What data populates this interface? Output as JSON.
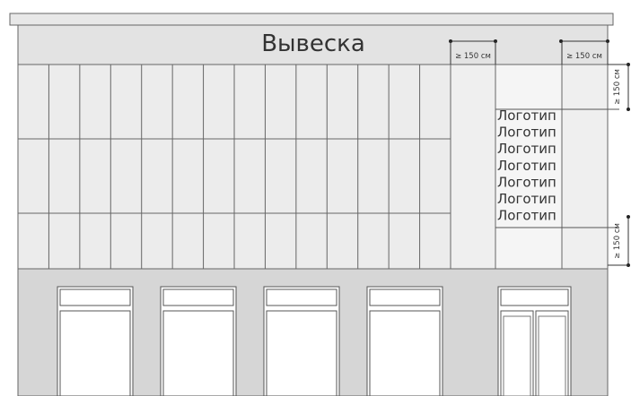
{
  "signboard": {
    "text": "Вывеска"
  },
  "dimensions": {
    "top_left_width": "≥ 150 см",
    "top_right_width": "≥ 150 см",
    "right_top_height": "≥ 150 см",
    "right_bottom_height": "≥ 150 см"
  },
  "logo": {
    "lines": [
      "Логотип",
      "Логотип",
      "Логотип",
      "Логотип",
      "Логотип",
      "Логотип",
      "Логотип"
    ]
  },
  "colors": {
    "stroke": "#555555",
    "panel_fill": "#ececec",
    "ground_floor": "#d6d6d6",
    "roof": "#e3e3e3",
    "text": "#333333"
  }
}
